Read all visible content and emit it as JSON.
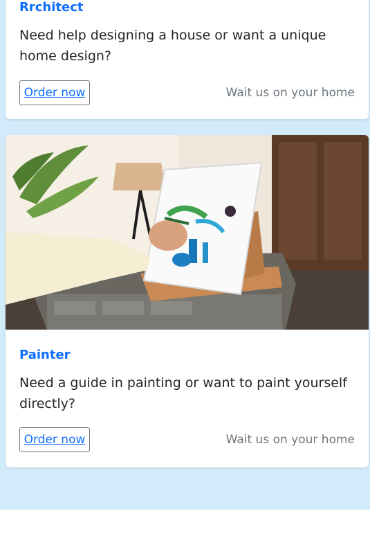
{
  "cards": [
    {
      "title": "Rrchitect",
      "text": "Need help designing a house or want a unique home design?",
      "button_label": "Order now",
      "note": "Wait us on your home"
    },
    {
      "title": "Painter",
      "text": "Need a guide in painting or want to paint yourself directly?",
      "button_label": "Order now",
      "note": "Wait us on your home",
      "image": "painting-easel-photo"
    }
  ],
  "colors": {
    "page_background": "#d1ebfa",
    "title": "#0d6efd",
    "text": "#212529",
    "muted": "#6c757d"
  }
}
